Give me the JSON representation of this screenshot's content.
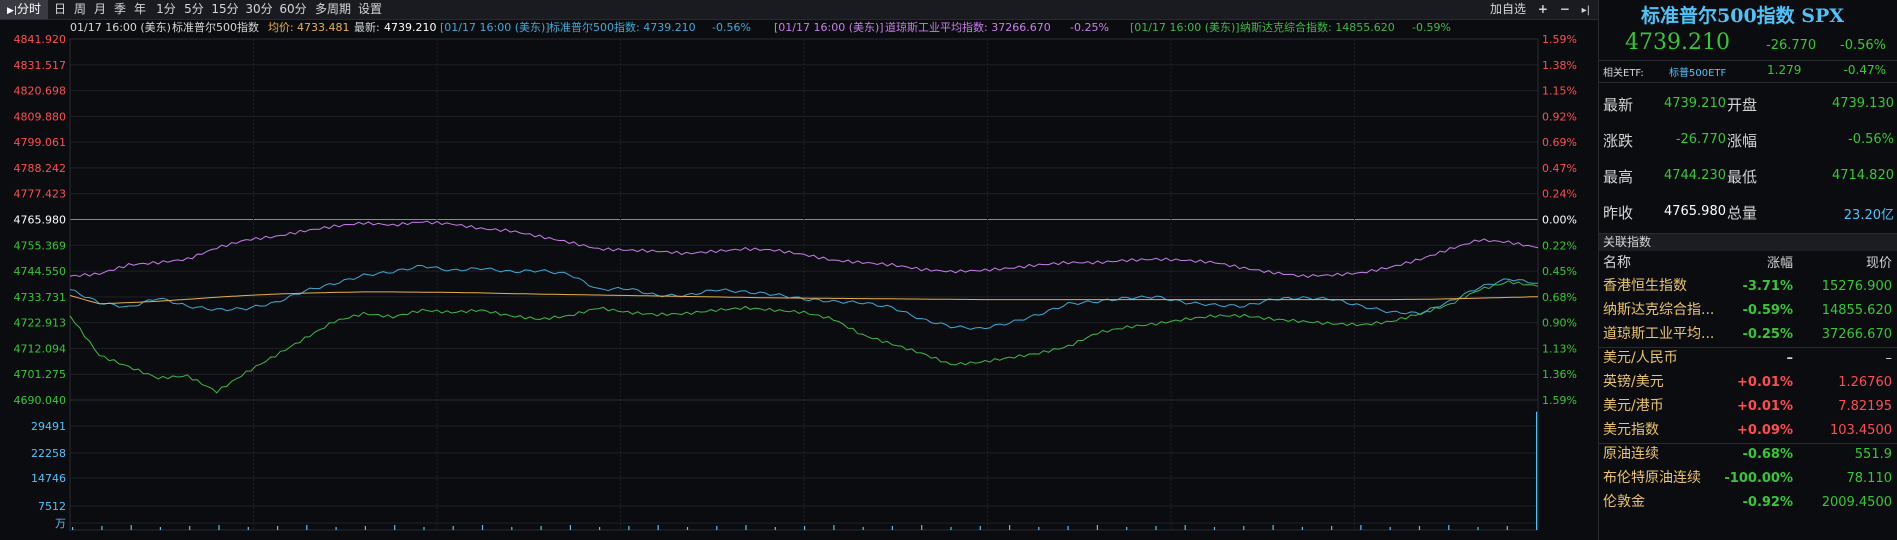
{
  "toolbar": {
    "items": [
      "分时",
      "日",
      "周",
      "月",
      "季",
      "年",
      "1分",
      "5分",
      "15分",
      "30分",
      "60分",
      "多周期",
      "设置"
    ],
    "active_index": 0,
    "add_watch": "加自选",
    "plus": "+",
    "minus": "−",
    "end": "▸|"
  },
  "legend": {
    "time": "01/17 16:00 (美东)",
    "name": "标准普尔500指数",
    "avg_label": "均价:",
    "avg_value": "4733.481",
    "last_label": "最新:",
    "last_value": "4739.210",
    "spx_time": "01/17 16:00 (美东)",
    "spx_text": "标准普尔500指数: 4739.210",
    "spx_pct": "-0.56%",
    "dji_time": "01/17 16:00 (美东)",
    "dji_text": "道琼斯工业平均指数: 37266.670",
    "dji_pct": "-0.25%",
    "ixic_time": "01/17 16:00 (美东)",
    "ixic_text": "纳斯达克综合指数: 14855.620",
    "ixic_pct": "-0.59%"
  },
  "colors": {
    "spx": "#3fa9d5",
    "dji": "#c77ee8",
    "ixic": "#3fb84a",
    "avg": "#e8b04a",
    "up": "#ff4d4f",
    "down": "#35c735",
    "grid": "#1e2026",
    "volume": "#4fc3f7"
  },
  "chart_data": {
    "type": "line",
    "price_ticks": [
      "4841.920",
      "4831.517",
      "4820.698",
      "4809.880",
      "4799.061",
      "4788.242",
      "4777.423",
      "4765.980",
      "4755.369",
      "4744.550",
      "4733.731",
      "4722.913",
      "4712.094",
      "4701.275",
      "4690.040"
    ],
    "pct_ticks": [
      "1.59%",
      "1.38%",
      "1.15%",
      "0.92%",
      "0.69%",
      "0.47%",
      "0.24%",
      "0.00%",
      "0.22%",
      "0.45%",
      "0.68%",
      "0.90%",
      "1.13%",
      "1.36%",
      "1.59%"
    ],
    "volume_ticks": [
      "29491",
      "22258",
      "14746",
      "7512",
      "万"
    ],
    "prev_close": 4765.98,
    "ylim": [
      4690.04,
      4841.92
    ],
    "series": [
      {
        "name": "标准普尔500指数",
        "values": [
          4736.5,
          4731.0,
          4729.0,
          4733.0,
          4729.5,
          4728.0,
          4728.5,
          4731.0,
          4736.0,
          4739.0,
          4742.5,
          4744.0,
          4746.5,
          4744.5,
          4745.5,
          4744.0,
          4744.5,
          4743.0,
          4736.5,
          4737.0,
          4734.0,
          4734.0,
          4736.5,
          4735.5,
          4734.5,
          4732.5,
          4731.5,
          4731.0,
          4729.0,
          4724.0,
          4721.0,
          4720.0,
          4722.5,
          4726.0,
          4730.5,
          4731.5,
          4733.0,
          4733.5,
          4731.0,
          4730.0,
          4729.5,
          4732.5,
          4733.0,
          4732.5,
          4729.5,
          4727.0,
          4726.5,
          4731.5,
          4737.5,
          4741.0,
          4739.2
        ]
      },
      {
        "name": "道琼斯工业平均指数",
        "pct": [
          -0.5,
          -0.48,
          -0.4,
          -0.38,
          -0.35,
          -0.25,
          -0.18,
          -0.15,
          -0.1,
          -0.06,
          -0.03,
          -0.05,
          -0.02,
          -0.04,
          -0.08,
          -0.1,
          -0.15,
          -0.2,
          -0.26,
          -0.27,
          -0.28,
          -0.3,
          -0.28,
          -0.26,
          -0.27,
          -0.31,
          -0.36,
          -0.38,
          -0.4,
          -0.44,
          -0.46,
          -0.45,
          -0.43,
          -0.4,
          -0.38,
          -0.38,
          -0.36,
          -0.35,
          -0.36,
          -0.38,
          -0.43,
          -0.47,
          -0.5,
          -0.49,
          -0.47,
          -0.42,
          -0.35,
          -0.26,
          -0.18,
          -0.2,
          -0.25
        ]
      },
      {
        "name": "纳斯达克综合指数",
        "pct": [
          -0.85,
          -1.2,
          -1.3,
          -1.4,
          -1.38,
          -1.52,
          -1.35,
          -1.2,
          -1.05,
          -0.9,
          -0.83,
          -0.86,
          -0.8,
          -0.82,
          -0.8,
          -0.85,
          -0.88,
          -0.85,
          -0.78,
          -0.82,
          -0.84,
          -0.83,
          -0.8,
          -0.78,
          -0.8,
          -0.82,
          -0.88,
          -1.02,
          -1.1,
          -1.18,
          -1.28,
          -1.26,
          -1.22,
          -1.18,
          -1.12,
          -1.0,
          -0.95,
          -0.92,
          -0.88,
          -0.85,
          -0.85,
          -0.88,
          -0.9,
          -0.92,
          -0.93,
          -0.9,
          -0.83,
          -0.75,
          -0.62,
          -0.55,
          -0.59
        ]
      },
      {
        "name": "均价",
        "values": [
          4734.0,
          4730.5,
          4731.0,
          4731.6,
          4732.4,
          4733.3,
          4734.0,
          4734.6,
          4735.0,
          4735.3,
          4735.5,
          4735.5,
          4735.4,
          4735.3,
          4735.1,
          4734.8,
          4734.6,
          4734.4,
          4734.2,
          4734.0,
          4733.8,
          4733.6,
          4733.4,
          4733.2,
          4733.0,
          4732.9,
          4732.8,
          4732.7,
          4732.6,
          4732.5,
          4732.4,
          4732.3,
          4732.3,
          4732.3,
          4732.3,
          4732.3,
          4732.3,
          4732.3,
          4732.3,
          4732.3,
          4732.3,
          4732.3,
          4732.3,
          4732.3,
          4732.3,
          4732.3,
          4732.4,
          4732.6,
          4732.9,
          4733.2,
          4733.5
        ]
      }
    ],
    "volume": [
      1,
      1,
      1,
      1,
      1,
      1,
      1,
      1,
      1,
      1,
      1,
      1,
      1,
      1,
      1,
      1,
      1,
      1,
      1,
      1,
      1,
      1,
      1,
      1,
      1,
      1,
      1,
      1,
      1,
      1,
      1,
      1,
      1,
      1,
      1,
      1,
      1,
      1,
      1,
      1,
      1,
      1,
      1,
      1,
      1,
      1,
      2,
      2,
      2,
      3,
      32000
    ],
    "volume_max": 33000
  },
  "panel": {
    "title": "标准普尔500指数 SPX",
    "price": "4739.210",
    "change": "-26.770",
    "change_pct": "-0.56%",
    "etf_label": "相关ETF:",
    "etf_name": "标普500ETF",
    "etf_price": "1.279",
    "etf_pct": "-0.47%",
    "quote": [
      {
        "l1": "最新",
        "v1": "4739.210",
        "l2": "开盘",
        "v2": "4739.130",
        "c1": "down",
        "c2": "down"
      },
      {
        "l1": "涨跌",
        "v1": "-26.770",
        "l2": "涨幅",
        "v2": "-0.56%",
        "c1": "down",
        "c2": "down"
      },
      {
        "l1": "最高",
        "v1": "4744.230",
        "l2": "最低",
        "v2": "4714.820",
        "c1": "down",
        "c2": "down"
      },
      {
        "l1": "昨收",
        "v1": "4765.980",
        "l2": "总量",
        "v2": "23.20亿",
        "c1": "white",
        "c2": "cyan"
      }
    ],
    "related_title": "关联指数",
    "related_head": [
      "名称",
      "涨幅",
      "现价"
    ],
    "related": [
      {
        "name": "香港恒生指数",
        "chg": "-3.71%",
        "px": "15276.900",
        "dir": "down"
      },
      {
        "name": "纳斯达克综合指...",
        "chg": "-0.59%",
        "px": "14855.620",
        "dir": "down"
      },
      {
        "name": "道琼斯工业平均...",
        "chg": "-0.25%",
        "px": "37266.670",
        "dir": "down"
      },
      {
        "name": "美元/人民币",
        "chg": "–",
        "px": "–",
        "dir": "white"
      },
      {
        "name": "英镑/美元",
        "chg": "+0.01%",
        "px": "1.26760",
        "dir": "up"
      },
      {
        "name": "美元/港币",
        "chg": "+0.01%",
        "px": "7.82195",
        "dir": "up"
      },
      {
        "name": "美元指数",
        "chg": "+0.09%",
        "px": "103.4500",
        "dir": "up"
      },
      {
        "name": "原油连续",
        "chg": "-0.68%",
        "px": "551.9",
        "dir": "down"
      },
      {
        "name": "布伦特原油连续",
        "chg": "-100.00%",
        "px": "78.110",
        "dir": "down"
      },
      {
        "name": "伦敦金",
        "chg": "-0.92%",
        "px": "2009.4500",
        "dir": "down"
      }
    ]
  }
}
